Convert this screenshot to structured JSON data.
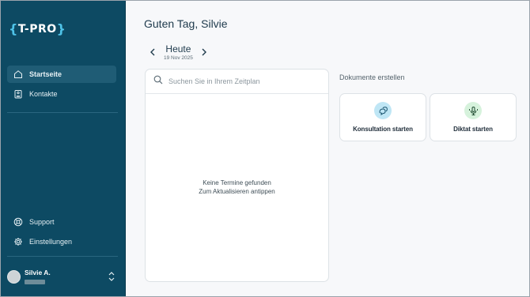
{
  "app": {
    "logo_text": "T-PRO"
  },
  "sidebar": {
    "items": [
      {
        "label": "Startseite",
        "icon": "home-icon",
        "active": true
      },
      {
        "label": "Kontakte",
        "icon": "contacts-icon",
        "active": false
      }
    ],
    "bottom_items": [
      {
        "label": "Support",
        "icon": "lifebuoy-icon"
      },
      {
        "label": "Einstellungen",
        "icon": "gear-icon"
      }
    ],
    "user": {
      "name": "Silvie A."
    }
  },
  "main": {
    "greeting": "Guten Tag, Silvie",
    "date": {
      "title": "Heute",
      "subtitle": "19 Nov 2025"
    },
    "search": {
      "placeholder": "Suchen Sie in Ihrem Zeitplan"
    },
    "empty": {
      "line1": "Keine Termine gefunden",
      "line2": "Zum Aktualisieren antippen"
    },
    "documents": {
      "title": "Dokumente erstellen",
      "cards": [
        {
          "label": "Konsultation starten",
          "icon": "consultation-icon",
          "color": "#bfe6f5"
        },
        {
          "label": "Diktat starten",
          "icon": "microphone-icon",
          "color": "#d6f2dc"
        }
      ]
    }
  },
  "colors": {
    "sidebar": "#0d4a63",
    "accent": "#4fc3e8",
    "active_item": "#1f5c75"
  }
}
